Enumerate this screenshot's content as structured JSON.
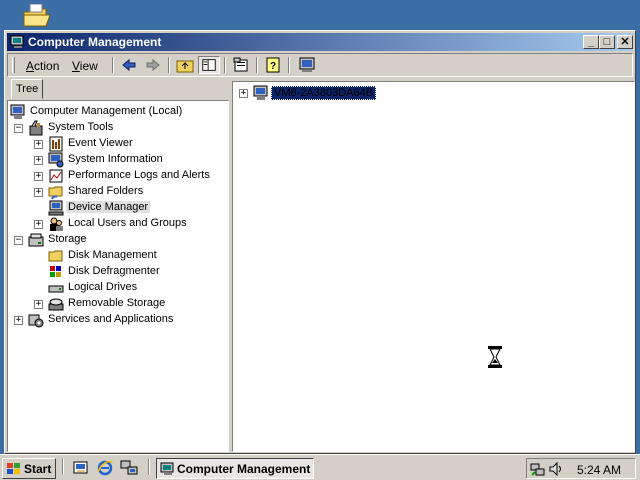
{
  "window": {
    "title": "Computer Management",
    "minimize": "_",
    "maximize": "□",
    "close": "✕"
  },
  "menubar": {
    "action_prefix": "",
    "action_underline": "A",
    "action_rest": "ction",
    "view_underline": "V",
    "view_rest": "iew",
    "toolbar_icons": [
      "back-icon",
      "forward-icon",
      "up-folder-icon",
      "show-hide-tree-icon",
      "properties-icon",
      "help-icon",
      "computer-icon"
    ]
  },
  "tree_tab": "Tree",
  "tree": {
    "root": "Computer Management (Local)",
    "system_tools": "System Tools",
    "event_viewer": "Event Viewer",
    "system_information": "System Information",
    "performance_logs": "Performance Logs and Alerts",
    "shared_folders": "Shared Folders",
    "device_manager": "Device Manager",
    "local_users": "Local Users and Groups",
    "storage": "Storage",
    "disk_management": "Disk Management",
    "disk_defragmenter": "Disk Defragmenter",
    "logical_drives": "Logical Drives",
    "removable_storage": "Removable Storage",
    "services_apps": "Services and Applications"
  },
  "detail": {
    "computer_name": "VM8-2A3803DA64B"
  },
  "taskbar": {
    "start_label": "Start",
    "task_label": "Computer Management",
    "clock": "5:24 AM"
  },
  "colors": {
    "desktop": "#3a6ea5",
    "titlebar_start": "#0a246a",
    "titlebar_end": "#a6caf0",
    "face": "#d4d0c8",
    "selection": "#0a246a"
  }
}
